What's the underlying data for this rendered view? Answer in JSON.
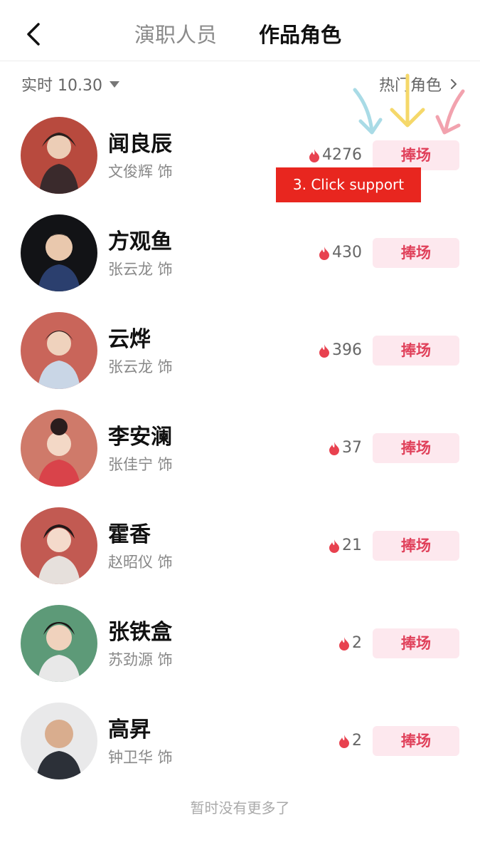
{
  "header": {
    "back_icon": "chevron-left-icon",
    "tabs": [
      {
        "label": "演职人员",
        "active": false
      },
      {
        "label": "作品角色",
        "active": true
      }
    ]
  },
  "subbar": {
    "filter_label": "实时 10.30",
    "filter_icon": "caret-down-icon",
    "hot_label": "热门角色",
    "hot_icon": "chevron-right-icon"
  },
  "roles": [
    {
      "name": "闻良辰",
      "actor": "文俊辉 饰",
      "heat": "4276",
      "button": "捧场"
    },
    {
      "name": "方观鱼",
      "actor": "张云龙 饰",
      "heat": "430",
      "button": "捧场"
    },
    {
      "name": "云烨",
      "actor": "张云龙 饰",
      "heat": "396",
      "button": "捧场"
    },
    {
      "name": "李安澜",
      "actor": "张佳宁 饰",
      "heat": "37",
      "button": "捧场"
    },
    {
      "name": "霍香",
      "actor": "赵昭仪 饰",
      "heat": "21",
      "button": "捧场"
    },
    {
      "name": "张铁盒",
      "actor": "苏劲源 饰",
      "heat": "2",
      "button": "捧场"
    },
    {
      "name": "高昇",
      "actor": "钟卫华 饰",
      "heat": "2",
      "button": "捧场"
    }
  ],
  "footer": {
    "text": "暂时没有更多了"
  },
  "annotation": {
    "text": "3. Click support",
    "box_color": "#e8261f",
    "arrow_colors": [
      "#a9dbe6",
      "#f5d86a",
      "#f2a2ae"
    ]
  },
  "colors": {
    "accent": "#e0405a",
    "button_bg": "#fde8ee",
    "flame": "#e8414f"
  }
}
